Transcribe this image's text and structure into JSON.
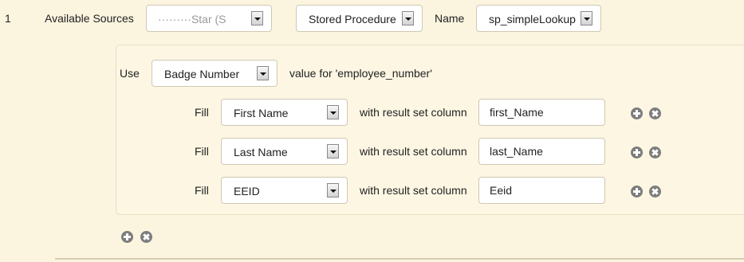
{
  "row": {
    "number": "1",
    "available_sources_label": "Available Sources",
    "available_sources_value": "·········Star (S",
    "source_type_value": "Stored Procedure",
    "name_label": "Name",
    "name_value": "sp_simpleLookup"
  },
  "use": {
    "label": "Use",
    "value": "Badge Number",
    "suffix": "value for 'employee_number'"
  },
  "fills": [
    {
      "fill_label": "Fill",
      "field": "First Name",
      "with_label": "with result set column",
      "column": "first_Name"
    },
    {
      "fill_label": "Fill",
      "field": "Last Name",
      "with_label": "with result set column",
      "column": "last_Name"
    },
    {
      "fill_label": "Fill",
      "field": "EEID",
      "with_label": "with result set column",
      "column": "Eeid"
    }
  ],
  "icons": {
    "add": "plus-circle-icon",
    "remove": "x-circle-icon"
  },
  "colors": {
    "background": "#fbf4df",
    "icon": "#7d7d7d",
    "border": "#cfc8b4"
  }
}
